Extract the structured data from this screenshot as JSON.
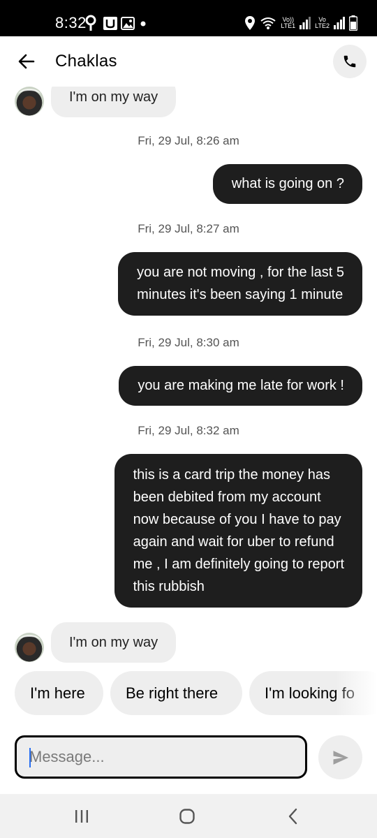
{
  "status_bar": {
    "time": "8:32",
    "network_1": "LTE1",
    "network_2": "LTE2",
    "volte_1": "Vo))",
    "volte_2": "Vo",
    "icons": [
      "location-pin-icon",
      "u-app-icon",
      "image-icon",
      "dot-icon",
      "location-icon",
      "wifi-icon",
      "signal-icon",
      "battery-icon"
    ]
  },
  "header": {
    "contact_name": "Chaklas",
    "back_icon": "arrow-left-icon",
    "call_icon": "phone-icon"
  },
  "messages": [
    {
      "type": "incoming",
      "text": "I'm on my way"
    },
    {
      "type": "timestamp",
      "text": "Fri, 29 Jul, 8:26 am"
    },
    {
      "type": "outgoing",
      "text": "what is going on ?"
    },
    {
      "type": "timestamp",
      "text": "Fri, 29 Jul, 8:27 am"
    },
    {
      "type": "outgoing",
      "lines": [
        "you are not moving , for the last 5",
        "minutes it's been saying 1 minute"
      ]
    },
    {
      "type": "timestamp",
      "text": "Fri, 29 Jul, 8:30 am"
    },
    {
      "type": "outgoing",
      "text": "you are making me late for work !"
    },
    {
      "type": "timestamp",
      "text": "Fri, 29 Jul, 8:32 am"
    },
    {
      "type": "outgoing",
      "lines": [
        "this is a card trip the money has",
        "been debited from my account",
        "now because of you I have to pay",
        "again and wait for uber to refund",
        "me , I am definitely going to report",
        "this rubbish"
      ]
    },
    {
      "type": "incoming",
      "text": "I'm on my way"
    }
  ],
  "quick_replies": [
    "I'm here",
    "Be right there",
    "I'm looking fo"
  ],
  "compose": {
    "placeholder": "Message...",
    "value": "",
    "send_icon": "send-icon"
  },
  "nav_bar": {
    "icons": [
      "recent-apps-icon",
      "home-icon",
      "back-icon"
    ]
  },
  "colors": {
    "outgoing_bubble": "#1e1e1e",
    "incoming_bubble": "#eeeeee",
    "timestamp_text": "#545454",
    "accent_caret": "#276ef1"
  }
}
